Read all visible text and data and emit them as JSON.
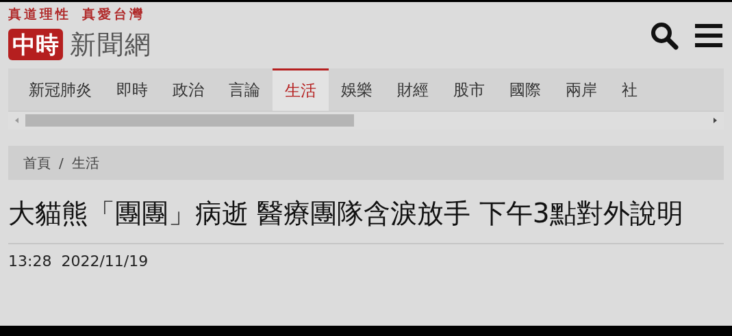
{
  "header": {
    "taglines": [
      "真道理性",
      "真愛台灣"
    ],
    "logo": {
      "mark": "中時",
      "name": "新聞網"
    }
  },
  "nav": {
    "tabs": [
      {
        "label": "新冠肺炎",
        "selected": false
      },
      {
        "label": "即時",
        "selected": false
      },
      {
        "label": "政治",
        "selected": false
      },
      {
        "label": "言論",
        "selected": false
      },
      {
        "label": "生活",
        "selected": true
      },
      {
        "label": "娛樂",
        "selected": false
      },
      {
        "label": "財經",
        "selected": false
      },
      {
        "label": "股市",
        "selected": false
      },
      {
        "label": "國際",
        "selected": false
      },
      {
        "label": "兩岸",
        "selected": false
      },
      {
        "label": "社",
        "selected": false
      }
    ]
  },
  "breadcrumb": {
    "items": [
      "首頁",
      "生活"
    ],
    "separator": "/"
  },
  "article": {
    "headline": "大貓熊「團團」病逝 醫療團隊含淚放手 下午3點對外說明",
    "time": "13:28",
    "date": "2022/11/19"
  }
}
